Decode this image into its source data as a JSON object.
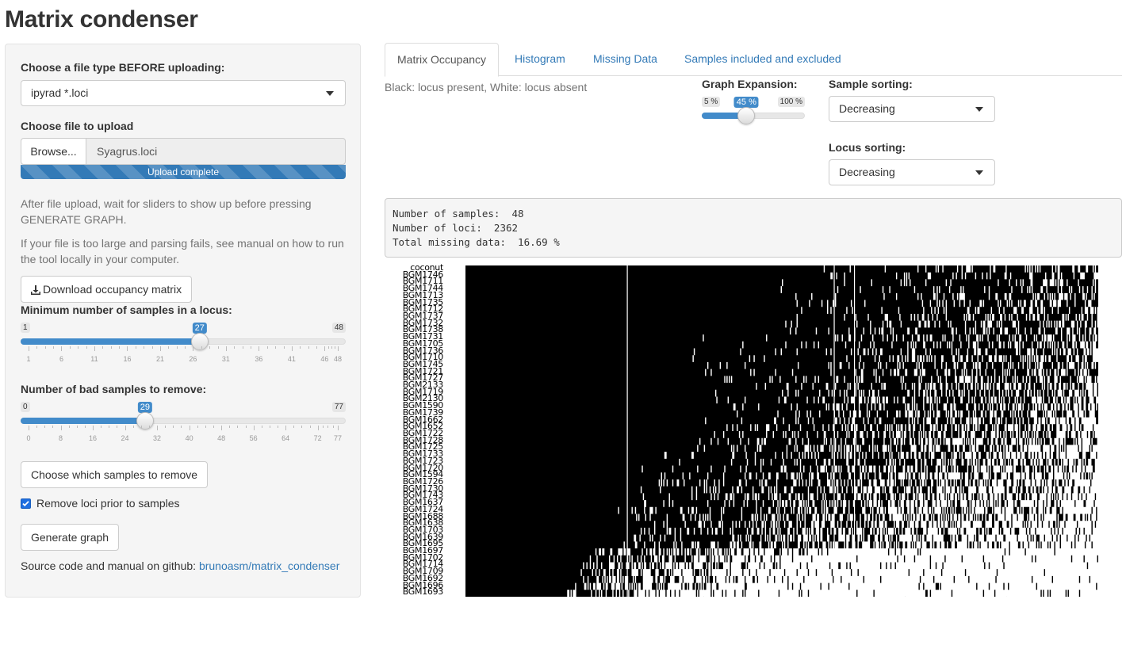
{
  "app": {
    "title": "Matrix condenser"
  },
  "sidebar": {
    "file_type_label": "Choose a file type BEFORE uploading:",
    "file_type_value": "ipyrad *.loci",
    "upload_label": "Choose file to upload",
    "browse_label": "Browse...",
    "file_name": "Syagrus.loci",
    "upload_status": "Upload complete",
    "upload_progress": 1.0,
    "help1": "After file upload, wait for sliders to show up before pressing GENERATE GRAPH.",
    "help2": "If your file is too large and parsing fails, see manual on how to run the tool locally in your computer.",
    "download_button": "Download occupancy matrix",
    "min_samples": {
      "label": "Minimum number of samples in a locus:",
      "min": 1,
      "max": 48,
      "value": 27,
      "ticks": [
        "1",
        "6",
        "11",
        "16",
        "21",
        "26",
        "31",
        "36",
        "41",
        "46",
        "48"
      ]
    },
    "bad_samples": {
      "label": "Number of bad samples to remove:",
      "min": 0,
      "max": 77,
      "value": 29,
      "ticks": [
        "0",
        "8",
        "16",
        "24",
        "32",
        "40",
        "48",
        "56",
        "64",
        "72",
        "77"
      ]
    },
    "choose_samples_button": "Choose which samples to remove",
    "remove_loci_label": "Remove loci prior to samples",
    "remove_loci_checked": true,
    "generate_button": "Generate graph",
    "footer_text": "Source code and manual on github: ",
    "footer_link": "brunoasm/matrix_condenser"
  },
  "main": {
    "tabs": [
      {
        "label": "Matrix Occupancy",
        "active": true
      },
      {
        "label": "Histogram",
        "active": false
      },
      {
        "label": "Missing Data",
        "active": false
      },
      {
        "label": "Samples included and excluded",
        "active": false
      }
    ],
    "legend_text": "Black: locus present, White: locus absent",
    "expansion": {
      "label": "Graph Expansion:",
      "min_label": "5 %",
      "max_label": "100 %",
      "value_label": "45 %",
      "value": 45,
      "min": 5,
      "max": 100
    },
    "sample_sorting": {
      "label": "Sample sorting:",
      "value": "Decreasing"
    },
    "locus_sorting": {
      "label": "Locus sorting:",
      "value": "Decreasing"
    },
    "summary": {
      "samples": "Number of samples:  48",
      "loci": "Number of loci:  2362",
      "missing": "Total missing data:  16.69 %"
    },
    "matrix": {
      "samples": [
        "coconut",
        "BGM1746",
        "BGM1711",
        "BGM1744",
        "BGM1713",
        "BGM1735",
        "BGM1712",
        "BGM1737",
        "BGM1732",
        "BGM1738",
        "BGM1731",
        "BGM1705",
        "BGM1736",
        "BGM1710",
        "BGM1745",
        "BGM1721",
        "BGM1727",
        "BGM2133",
        "BGM1719",
        "BGM2130",
        "BGM1590",
        "BGM1739",
        "BGM1662",
        "BGM1652",
        "BGM1722",
        "BGM1728",
        "BGM1725",
        "BGM1733",
        "BGM1723",
        "BGM1720",
        "BGM1594",
        "BGM1726",
        "BGM1730",
        "BGM1743",
        "BGM1637",
        "BGM1724",
        "BGM1688",
        "BGM1638",
        "BGM1703",
        "BGM1639",
        "BGM1695",
        "BGM1697",
        "BGM1702",
        "BGM1714",
        "BGM1709",
        "BGM1692",
        "BGM1696",
        "BGM1693"
      ],
      "colors": {
        "present": "#000000",
        "absent": "#ffffff"
      }
    }
  }
}
